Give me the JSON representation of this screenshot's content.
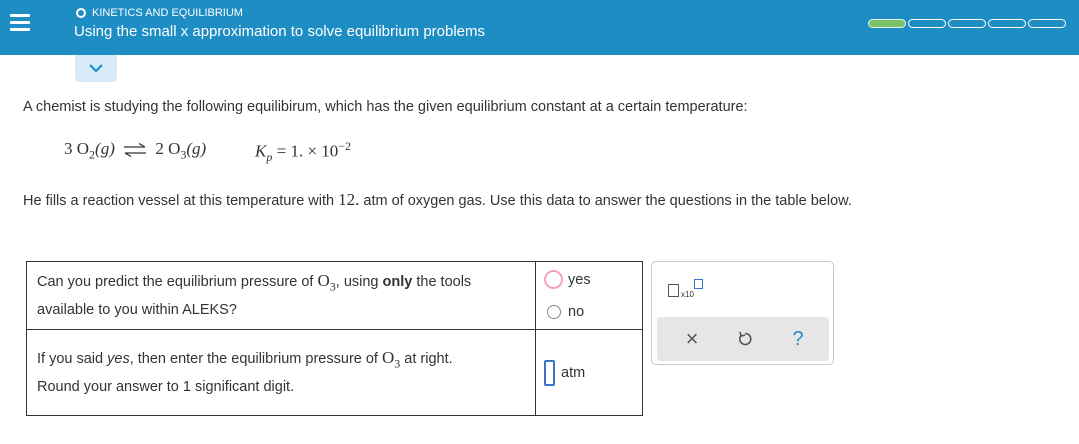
{
  "header": {
    "topic": "KINETICS AND EQUILIBRIUM",
    "lesson_title": "Using the small x approximation to solve equilibrium problems",
    "progress": {
      "segments": 5,
      "completed": 1
    },
    "colors": {
      "bar": "#1e8dc4",
      "progress_fill": "#7ac36a"
    }
  },
  "problem": {
    "intro": "A chemist is studying the following equilibirum, which has the given equilibrium constant at a certain temperature:",
    "reaction": {
      "reactant_coef": "3",
      "reactant": "O",
      "reactant_sub": "2",
      "reactant_phase": "(g)",
      "product_coef": "2",
      "product": "O",
      "product_sub": "3",
      "product_phase": "(g)"
    },
    "kp": {
      "symbol": "K",
      "sub": "p",
      "equals": "=",
      "value": "1. × 10",
      "exponent": "−2"
    },
    "data_pre": "He fills a reaction vessel at this temperature with ",
    "data_value": "12.",
    "data_post": " atm of oxygen gas. Use this data to answer the questions in the table below."
  },
  "table": {
    "q1": {
      "pre": "Can you predict the equilibrium pressure of ",
      "species": "O",
      "species_sub": "3",
      "mid": ", using ",
      "bold": "only",
      "post": " the tools",
      "line2": "available to you within ALEKS?"
    },
    "options": [
      "yes",
      "no"
    ],
    "q2": {
      "pre": "If you said ",
      "italic": "yes",
      "mid": ", then enter the equilibrium pressure of ",
      "species": "O",
      "species_sub": "3",
      "post": " at right.",
      "line2": "Round your answer to 1 significant digit."
    },
    "unit": "atm"
  },
  "panel": {
    "sci_notation_label": "x10",
    "tools": [
      "clear-icon",
      "undo-icon",
      "help-icon"
    ],
    "help_glyph": "?",
    "clear_glyph": "×"
  }
}
